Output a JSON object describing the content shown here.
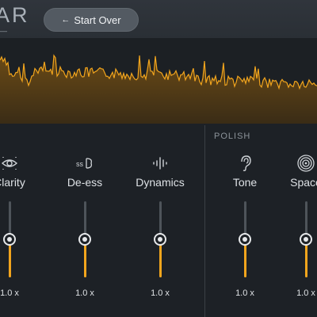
{
  "header": {
    "app_title": "AR",
    "app_subtitle": "—",
    "start_over_label": "Start Over"
  },
  "colors": {
    "accent": "#f2a51d",
    "background": "#1d2126",
    "spectrum_fill": "#4a3616"
  },
  "sections": {
    "polish_label": "POLISH"
  },
  "modules": [
    {
      "name": "Clarity",
      "icon": "eye-icon",
      "value_label": "1.0 x",
      "level": 0.5
    },
    {
      "name": "De-ess",
      "icon": "de-ess-icon",
      "value_label": "1.0 x",
      "level": 0.5
    },
    {
      "name": "Dynamics",
      "icon": "waveform-icon",
      "value_label": "1.0 x",
      "level": 0.5
    },
    {
      "name": "Tone",
      "icon": "ear-icon",
      "value_label": "1.0 x",
      "level": 0.5
    },
    {
      "name": "Space",
      "icon": "target-icon",
      "value_label": "1.0 x",
      "level": 0.5
    }
  ]
}
